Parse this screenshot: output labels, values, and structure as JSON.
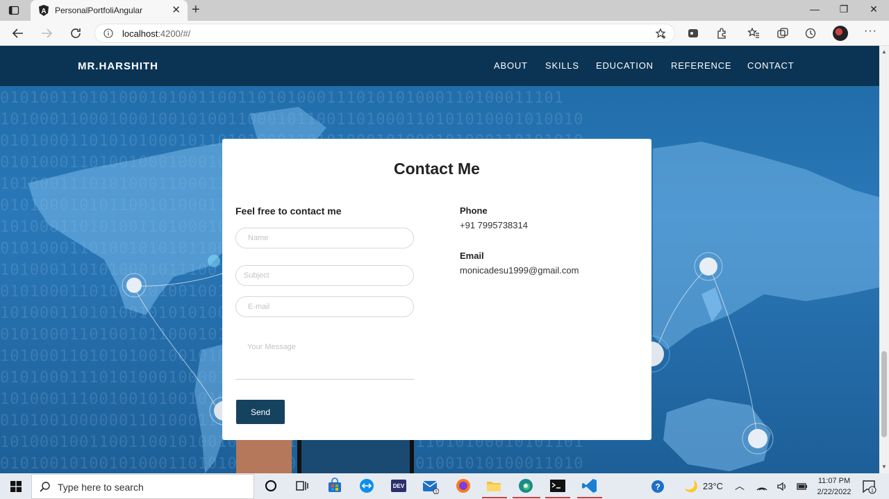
{
  "browser": {
    "tab_title": "PersonalPortfoliAngular",
    "url_host": "localhost",
    "url_rest": ":4200/#/"
  },
  "site": {
    "brand": "MR.HARSHITH",
    "nav": [
      "ABOUT",
      "SKILLS",
      "EDUCATION",
      "REFERENCE",
      "CONTACT"
    ]
  },
  "background_binary": [
    "010100110101000101001100110101000111010101000110100011101",
    "10100011000100010010100110001011001101000110101010001010010",
    "01010001101010100010110101000110101000101000101000110101010",
    "01010001101001000100010100100011010100110100010100010110101",
    "10100011101010001100011010100001010101011010000100011010101",
    "01010001010110010100011010101001010001000110101010001101010",
    "10100011010100110100010100100101000101010001010100001011010",
    "01010001101001010101100101100100010100011001010001101100101",
    "10100011010100010111001010001100101000100110100011010100011",
    "01010001101000101001001001000101001100001000101000110101010",
    "10100011010100101010100011001010001100010100101001101001010",
    "01010001101001011000101001010000100011010100101001000110101",
    "10100011010101001001010001100110101000111001010001101001010",
    "01010001110101000100001010110101000110010101100010100101101",
    "10100011100100101001010001000010101001110100100011001010001",
    "01010010000001101000110101001010001001011100101000110010101",
    "10100010011001100101001010001100101000100011010100010101101",
    "01010010100101000110101000101001010110001101001010100011010"
  ],
  "contact": {
    "title": "Contact Me",
    "form_heading": "Feel free to contact me",
    "name_placeholder": "Name",
    "subject_placeholder": "Subject",
    "email_placeholder": "E-mail",
    "message_placeholder": "Your Message",
    "send_label": "Send",
    "phone_label": "Phone",
    "phone_value": "+91 7995738314",
    "email_label": "Email",
    "email_value": "monicadesu1999@gmail.com"
  },
  "taskbar": {
    "search_placeholder": "Type here to search",
    "weather": "23°C",
    "time": "11:07 PM",
    "date": "2/22/2022",
    "mail_badge": "1",
    "notification_badge": "1"
  },
  "colors": {
    "nav_bg": "#0b3454",
    "send_button": "#15425f",
    "page_bg": "#2a78b8"
  }
}
